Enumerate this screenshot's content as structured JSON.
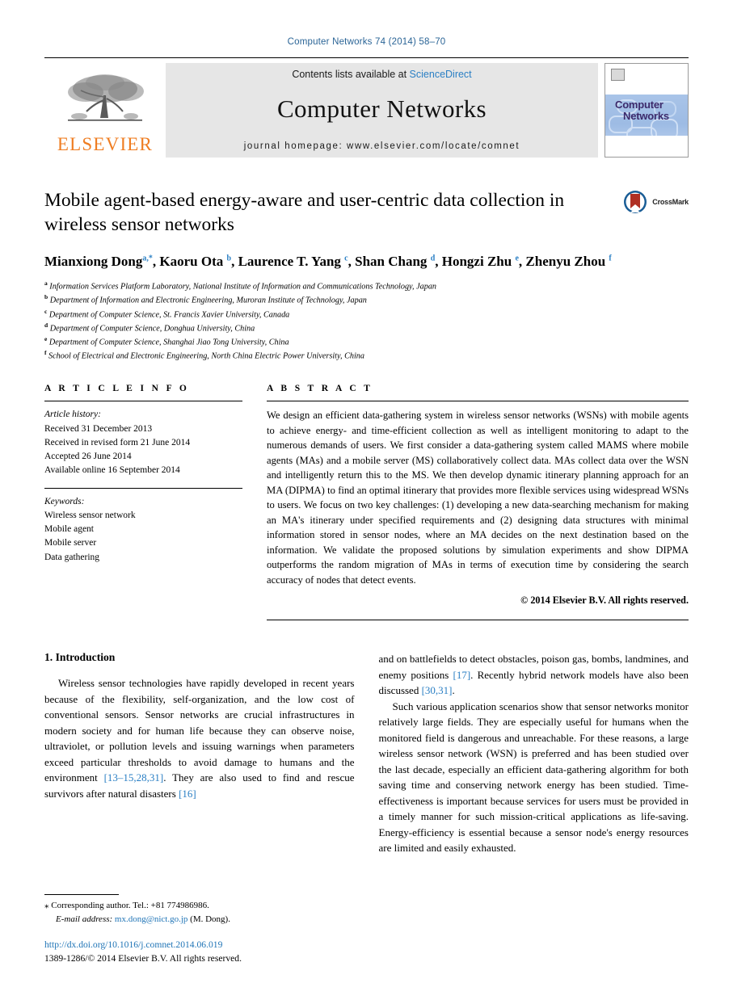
{
  "running_head": "Computer Networks 74 (2014) 58–70",
  "journal_header": {
    "publisher_name": "ELSEVIER",
    "contents_prefix": "Contents lists available at ",
    "sciencedirect": "ScienceDirect",
    "journal_title": "Computer Networks",
    "homepage": "journal homepage: www.elsevier.com/locate/comnet",
    "cover_title_line1": "Computer",
    "cover_title_line2": "Networks"
  },
  "article": {
    "title": "Mobile agent-based energy-aware and user-centric data collection in wireless sensor networks",
    "crossmark_label": "CrossMark",
    "authors": [
      {
        "name": "Mianxiong Dong",
        "sup": "a,*"
      },
      {
        "name": "Kaoru Ota",
        "sup": "b"
      },
      {
        "name": "Laurence T. Yang",
        "sup": "c"
      },
      {
        "name": "Shan Chang",
        "sup": "d"
      },
      {
        "name": "Hongzi Zhu",
        "sup": "e"
      },
      {
        "name": "Zhenyu Zhou",
        "sup": "f"
      }
    ],
    "affiliations": [
      {
        "marker": "a",
        "text": "Information Services Platform Laboratory, National Institute of Information and Communications Technology, Japan"
      },
      {
        "marker": "b",
        "text": "Department of Information and Electronic Engineering, Muroran Institute of Technology, Japan"
      },
      {
        "marker": "c",
        "text": "Department of Computer Science, St. Francis Xavier University, Canada"
      },
      {
        "marker": "d",
        "text": "Department of Computer Science, Donghua University, China"
      },
      {
        "marker": "e",
        "text": "Department of Computer Science, Shanghai Jiao Tong University, China"
      },
      {
        "marker": "f",
        "text": "School of Electrical and Electronic Engineering, North China Electric Power University, China"
      }
    ]
  },
  "article_info": {
    "heading": "A R T I C L E    I N F O",
    "history_label": "Article history:",
    "history": [
      "Received 31 December 2013",
      "Received in revised form 21 June 2014",
      "Accepted 26 June 2014",
      "Available online 16 September 2014"
    ],
    "keywords_label": "Keywords:",
    "keywords": [
      "Wireless sensor network",
      "Mobile agent",
      "Mobile server",
      "Data gathering"
    ]
  },
  "abstract": {
    "heading": "A B S T R A C T",
    "text": "We design an efficient data-gathering system in wireless sensor networks (WSNs) with mobile agents to achieve energy- and time-efficient collection as well as intelligent monitoring to adapt to the numerous demands of users. We first consider a data-gathering system called MAMS where mobile agents (MAs) and a mobile server (MS) collaboratively collect data. MAs collect data over the WSN and intelligently return this to the MS. We then develop dynamic itinerary planning approach for an MA (DIPMA) to find an optimal itinerary that provides more flexible services using widespread WSNs to users. We focus on two key challenges: (1) developing a new data-searching mechanism for making an MA's itinerary under specified requirements and (2) designing data structures with minimal information stored in sensor nodes, where an MA decides on the next destination based on the information. We validate the proposed solutions by simulation experiments and show DIPMA outperforms the random migration of MAs in terms of execution time by considering the search accuracy of nodes that detect events.",
    "copyright": "© 2014 Elsevier B.V. All rights reserved."
  },
  "introduction": {
    "section_title": "1. Introduction",
    "left_para1_a": "Wireless sensor technologies have rapidly developed in recent years because of the flexibility, self-organization, and the low cost of conventional sensors. Sensor networks are crucial infrastructures in modern society and for human life because they can observe noise, ultraviolet, or pollution levels and issuing warnings when parameters exceed particular thresholds to avoid damage to humans and the environment ",
    "left_ref1": "[13–15,28,31]",
    "left_para1_b": ". They are also used to find and rescue survivors after natural disasters ",
    "left_ref2": "[16]",
    "right_para1_a": "and on battlefields to detect obstacles, poison gas, bombs, landmines, and enemy positions ",
    "right_ref1": "[17]",
    "right_para1_b": ". Recently hybrid network models have also been discussed ",
    "right_ref2": "[30,31]",
    "right_para1_c": ".",
    "right_para2": "Such various application scenarios show that sensor networks monitor relatively large fields. They are especially useful for humans when the monitored field is dangerous and unreachable. For these reasons, a large wireless sensor network (WSN) is preferred and has been studied over the last decade, especially an efficient data-gathering algorithm for both saving time and conserving network energy has been studied. Time-effectiveness is important because services for users must be provided in a timely manner for such mission-critical applications as life-saving. Energy-efficiency is essential because a sensor node's energy resources are limited and easily exhausted."
  },
  "footnotes": {
    "corresponding_star": "⁎",
    "corresponding": "Corresponding author. Tel.: +81 774986986.",
    "email_label": "E-mail address:",
    "email": "mx.dong@nict.go.jp",
    "email_suffix": "(M. Dong).",
    "doi": "http://dx.doi.org/10.1016/j.comnet.2014.06.019",
    "issn": "1389-1286/© 2014 Elsevier B.V. All rights reserved."
  },
  "colors": {
    "link_blue": "#1f74b6",
    "running_head_blue": "#2a6496",
    "elsevier_orange": "#ef7d22",
    "cover_blue": "#a9c4e8"
  }
}
